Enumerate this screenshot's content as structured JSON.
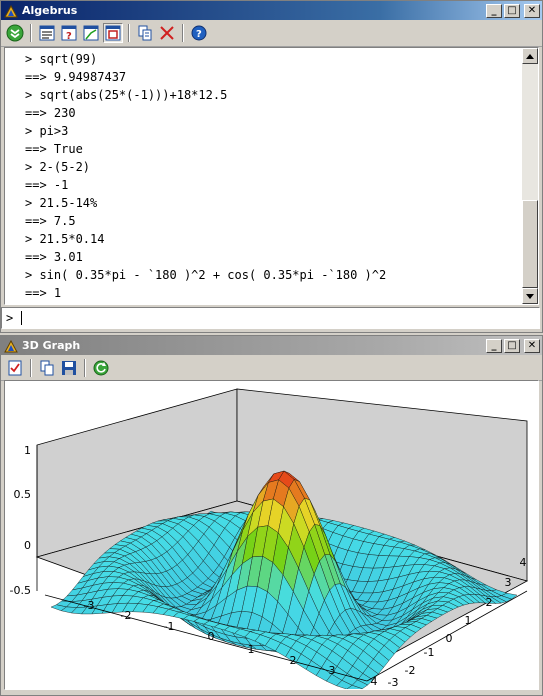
{
  "algebrus": {
    "title": "Algebrus",
    "window_buttons": {
      "minimize": "_",
      "maximize": "□",
      "close": "✕"
    },
    "console_lines": [
      "> sqrt(99)",
      "==> 9.94987437",
      "> sqrt(abs(25*(-1)))+18*12.5",
      "==> 230",
      "> pi>3",
      "==> True",
      "> 2-(5-2)",
      "==> -1",
      "> 21.5-14%",
      "==> 7.5",
      "> 21.5*0.14",
      "==> 3.01",
      "> sin( 0.35*pi - `180 )^2 + cos( 0.35*pi -`180 )^2",
      "==> 1"
    ],
    "input_prompt": ">"
  },
  "graph": {
    "title": "3D Graph",
    "z_ticks": [
      "1",
      "0.5",
      "0",
      "-0.5"
    ],
    "x_ticks": [
      "-3",
      "-2",
      "-1",
      "0",
      "1",
      "2",
      "3",
      "4"
    ],
    "y_ticks": [
      "4",
      "3",
      "2",
      "1",
      "0",
      "-1",
      "-2",
      "-3"
    ],
    "colors": {
      "plot_bg": "#d0d0d0",
      "peak": "#e53018",
      "mid": "#7ad10a",
      "base": "#40c8e0"
    }
  }
}
